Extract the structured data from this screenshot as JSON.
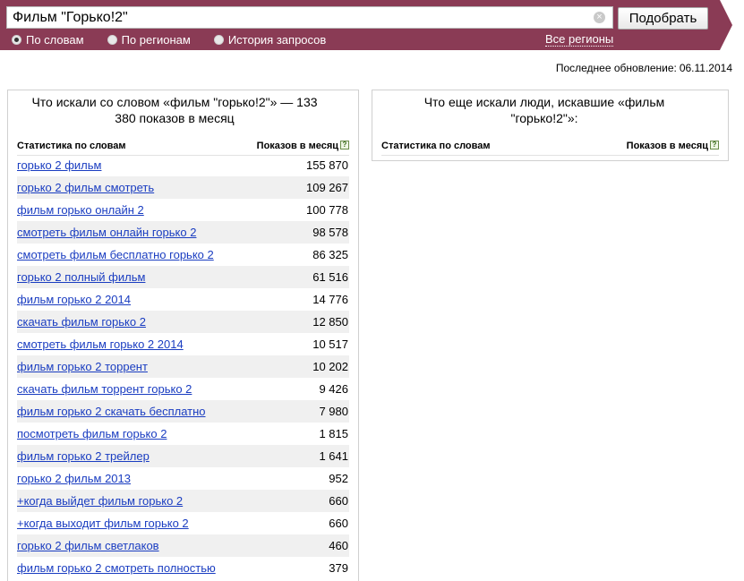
{
  "search": {
    "query": "Фильм \"Горько!2\"",
    "submit_label": "Подобрать",
    "clear_symbol": "×"
  },
  "modes": [
    {
      "label": "По словам",
      "checked": true
    },
    {
      "label": "По регионам",
      "checked": false
    },
    {
      "label": "История запросов",
      "checked": false
    }
  ],
  "regions_link": "Все регионы",
  "update": {
    "label": "Последнее обновление:",
    "date": "06.11.2014"
  },
  "colors": {
    "header_bg": "#8a3b55",
    "link": "#1a3dc1",
    "row_alt": "#f0f0f0"
  },
  "left_panel": {
    "title": "Что искали со словом «фильм \"горько!2\"» — 133 380 показов в месяц",
    "col_words": "Статистика по словам",
    "col_shows": "Показов в месяц",
    "help": "?",
    "rows": [
      {
        "query": "горько 2 фильм",
        "count": "155 870"
      },
      {
        "query": "горько 2 фильм смотреть",
        "count": "109 267"
      },
      {
        "query": "фильм горько онлайн 2",
        "count": "100 778"
      },
      {
        "query": "смотреть фильм онлайн горько 2",
        "count": "98 578"
      },
      {
        "query": "смотреть фильм бесплатно горько 2",
        "count": "86 325"
      },
      {
        "query": "горько 2 полный фильм",
        "count": "61 516"
      },
      {
        "query": "фильм горько 2 2014",
        "count": "14 776"
      },
      {
        "query": "скачать фильм горько 2",
        "count": "12 850"
      },
      {
        "query": "смотреть фильм горько 2 2014",
        "count": "10 517"
      },
      {
        "query": "фильм горько 2 торрент",
        "count": "10 202"
      },
      {
        "query": "скачать фильм торрент горько 2",
        "count": "9 426"
      },
      {
        "query": "фильм горько 2 скачать бесплатно",
        "count": "7 980"
      },
      {
        "query": "посмотреть фильм горько 2",
        "count": "1 815"
      },
      {
        "query": "фильм горько 2 трейлер",
        "count": "1 641"
      },
      {
        "query": "горько 2 фильм 2013",
        "count": "952"
      },
      {
        "query": "+когда выйдет фильм горько 2",
        "count": "660"
      },
      {
        "query": "+когда выходит фильм горько 2",
        "count": "660"
      },
      {
        "query": "горько 2 фильм светлаков",
        "count": "460"
      },
      {
        "query": "фильм горько 2 смотреть полностью",
        "count": "379"
      }
    ]
  },
  "right_panel": {
    "title": "Что еще искали люди, искавшие «фильм \"горько!2\"»:",
    "col_words": "Статистика по словам",
    "col_shows": "Показов в месяц",
    "help": "?"
  }
}
